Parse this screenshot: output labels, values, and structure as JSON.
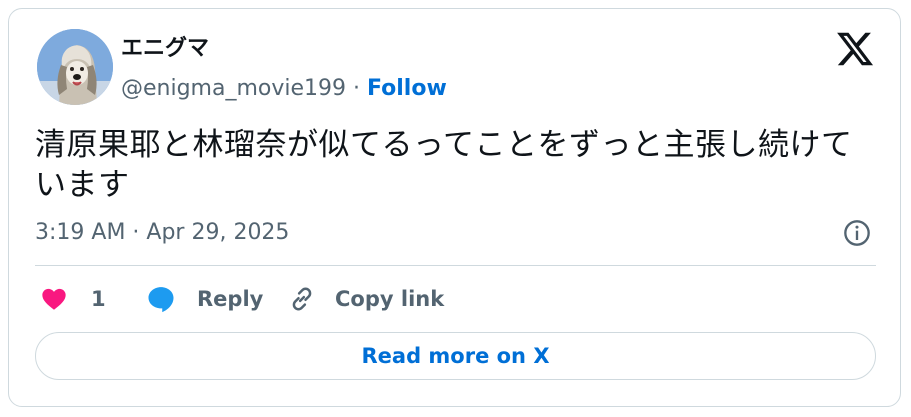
{
  "author": {
    "display_name": "エニグマ",
    "handle": "@enigma_movie199",
    "separator": " · ",
    "follow_label": "Follow"
  },
  "tweet": {
    "text": "清原果耶と林瑠奈が似てるってことをずっと主張し続けています",
    "timestamp": "3:19 AM · Apr 29, 2025"
  },
  "actions": {
    "like_count": "1",
    "reply_label": "Reply",
    "copy_link_label": "Copy link"
  },
  "read_more_label": "Read more on X",
  "colors": {
    "accent_blue": "#006fd6",
    "like_pink": "#f91880",
    "reply_blue": "#1d9bf0",
    "text_secondary": "#536471",
    "border": "#cfd9de"
  },
  "icons": {
    "logo": "x-logo-icon",
    "info": "info-icon",
    "like": "heart-icon",
    "reply": "speech-bubble-icon",
    "copy": "link-icon"
  }
}
